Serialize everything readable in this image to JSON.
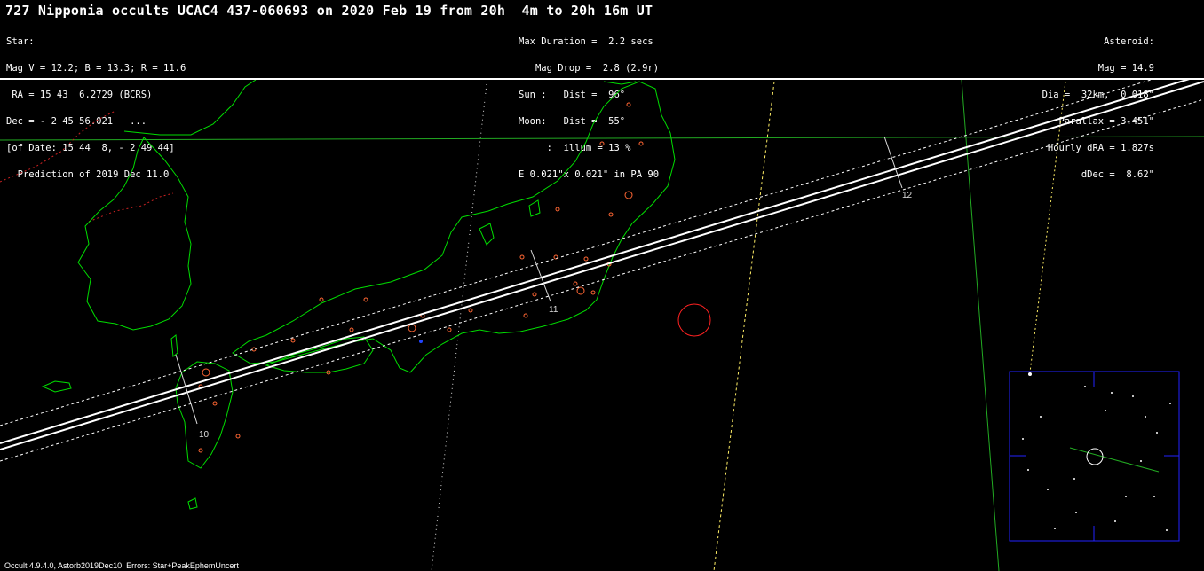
{
  "title": "727 Nipponia occults UCAC4 437-060693 on 2020 Feb 19 from 20h  4m to 20h 16m UT",
  "star_block": [
    "Star:",
    "Mag V = 12.2; B = 13.3; R = 11.6",
    " RA = 15 43  6.2729 (BCRS)",
    "Dec = - 2 45 56.021   ...",
    "[of Date: 15 44  8, - 2 49 44]",
    "  Prediction of 2019 Dec 11.0"
  ],
  "event_block": [
    "Max Duration =  2.2 secs",
    "   Mag Drop =  2.8 (2.9r)",
    "Sun :   Dist =  96°",
    "Moon:   Dist =  55°",
    "     :  illum = 13 %",
    "E 0.021\"x 0.021\" in PA 90"
  ],
  "asteroid_block": [
    "Asteroid:",
    "Mag = 14.9",
    "Dia =  32km,  0.018\"",
    "Parallax = 3.451\"",
    "Hourly dRA = 1.827s",
    "dDec =  8.62\""
  ],
  "time_labels": [
    "10",
    "11",
    "12"
  ],
  "footer": "Occult 4.9.4.0, Astorb2019Dec10  Errors: Star+PeakEphemUncert",
  "colors": {
    "coastline": "#00dd00",
    "border": "#cc2222",
    "city": "#ff6633",
    "path": "#ffffff",
    "night_limit": "#ffff66",
    "grid": "#22aa22",
    "finder_frame": "#2222ff"
  }
}
